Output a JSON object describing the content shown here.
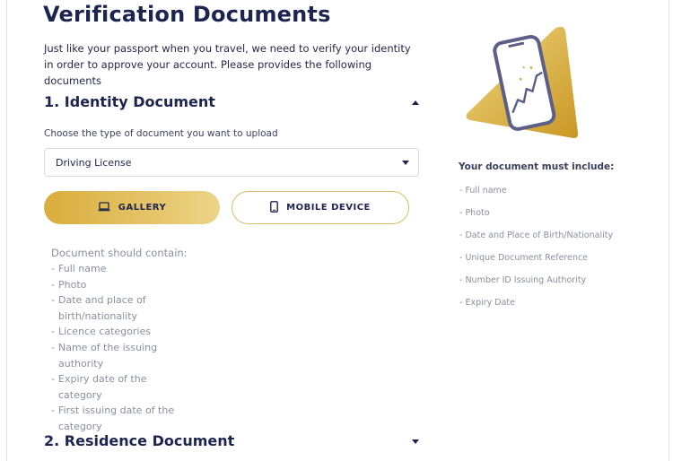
{
  "page": {
    "title": "Verification Documents",
    "intro": "Just like your passport when you travel, we need to verify your identity in order to approve your account. Please provides the following documents"
  },
  "identity_section": {
    "heading": "1. Identity Document",
    "caret_icon": "chevron-up-icon",
    "choose_label": "Choose the type of document you want to upload",
    "document_type_selected": "Driving License",
    "gallery_button": {
      "label": "GALLERY",
      "icon": "laptop-icon"
    },
    "mobile_button": {
      "label": "MOBILE DEVICE",
      "icon": "smartphone-icon"
    },
    "contain": {
      "heading": "Document should contain:",
      "items": [
        "Full name",
        "Photo",
        "Date and place of birth/nationality",
        "Licence categories",
        "Name of the issuing authority",
        "Expiry date of the category",
        "First issuing date of the category"
      ]
    }
  },
  "residence_section": {
    "heading": "2. Residence Document",
    "caret_icon": "chevron-down-icon"
  },
  "requirements": {
    "heading": "Your document must include:",
    "items": [
      "Full name",
      "Photo",
      "Date and Place of Birth/Nationality",
      "Unique Document Reference",
      "Number ID Issuing Authority",
      "Expiry Date"
    ]
  },
  "colors": {
    "navy": "#1d2450",
    "gold": "#d9ad3c",
    "gold_light": "#ecd487",
    "muted": "#8a8ea2"
  }
}
